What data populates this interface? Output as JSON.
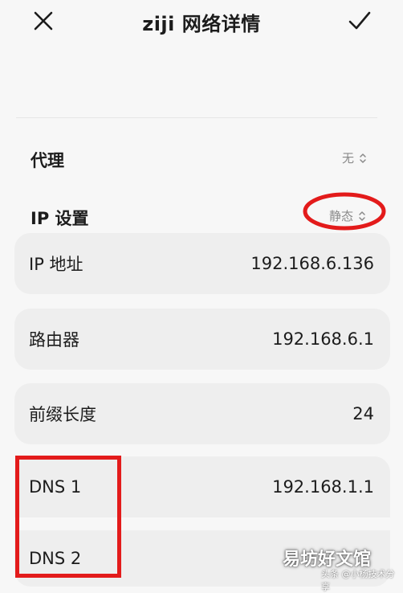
{
  "header": {
    "title": "ziji 网络详情",
    "close_icon": "close-icon",
    "confirm_icon": "checkmark-icon"
  },
  "proxy": {
    "label": "代理",
    "value": "无"
  },
  "ip_settings": {
    "label": "IP 设置",
    "value": "静态"
  },
  "fields": [
    {
      "label": "IP 地址",
      "value": "192.168.6.136"
    },
    {
      "label": "路由器",
      "value": "192.168.6.1"
    },
    {
      "label": "前缀长度",
      "value": "24"
    },
    {
      "label": "DNS 1",
      "value": "192.168.1.1"
    },
    {
      "label": "DNS 2",
      "value": ""
    }
  ],
  "annotations": {
    "ellipse_color": "#e31b1b",
    "rect_color": "#e31b1b"
  },
  "watermark": {
    "main": "易坊好文馆",
    "source_prefix": "头条",
    "source": "@小杨技术分享"
  }
}
